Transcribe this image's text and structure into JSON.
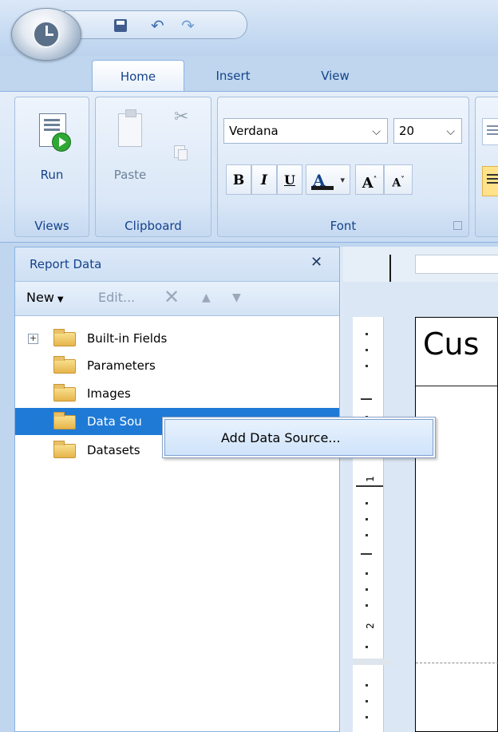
{
  "tabs": [
    "Home",
    "Insert",
    "View"
  ],
  "ribbon": {
    "groups": {
      "views": "Views",
      "clipboard": "Clipboard",
      "font": "Font"
    },
    "run_label": "Run",
    "paste_label": "Paste",
    "font_name": "Verdana",
    "font_size": "20",
    "bold": "B",
    "italic": "I",
    "underline": "U",
    "font_color": "A",
    "grow_font": "A",
    "shrink_font": "A"
  },
  "panel": {
    "title": "Report Data",
    "close": "✕",
    "toolbar": {
      "new": "New",
      "edit": "Edit..."
    },
    "tree": [
      {
        "label": "Built-in Fields",
        "expandable": true
      },
      {
        "label": "Parameters"
      },
      {
        "label": "Images"
      },
      {
        "label": "Data Sou",
        "selected": true
      },
      {
        "label": "Datasets"
      }
    ]
  },
  "context_menu": {
    "items": [
      "Add Data Source..."
    ]
  },
  "report": {
    "title_text": "Cus",
    "ruler_labels": [
      "1",
      "2"
    ]
  },
  "colors": {
    "selection": "#1f7ad6",
    "panel_header": "#dce9f8",
    "ribbon_text": "#15428b"
  }
}
